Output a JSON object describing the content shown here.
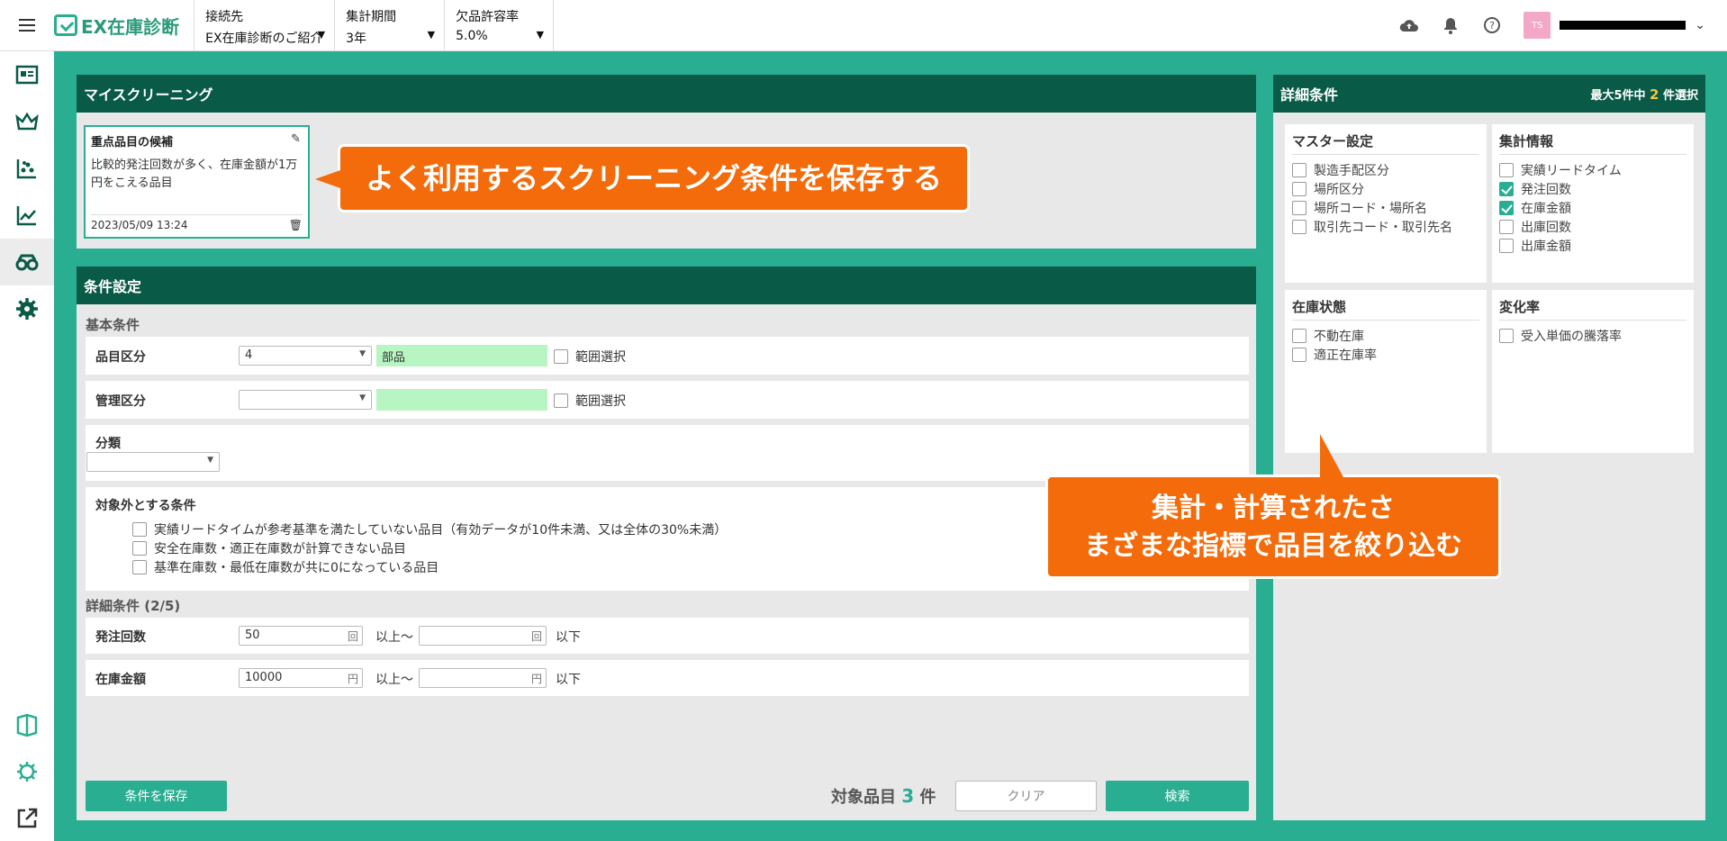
{
  "header": {
    "logo": "EX在庫診断",
    "connection": {
      "label": "接続先",
      "value": "EX在庫診断のご紹介"
    },
    "period": {
      "label": "集計期間",
      "value": "3年"
    },
    "tolerance": {
      "label": "欠品許容率",
      "value": "5.0%"
    },
    "avatar": "TS"
  },
  "my_screening": {
    "title": "マイスクリーニング",
    "card": {
      "title": "重点品目の候補",
      "description": "比較的発注回数が多く、在庫金額が1万円をこえる品目",
      "date": "2023/05/09 13:24"
    }
  },
  "callouts": {
    "save": "よく利用するスクリーニング条件を保存する",
    "filter_line1": "集計・計算されたさ",
    "filter_line2": "まざまな指標で品目を絞り込む"
  },
  "conditions": {
    "title": "条件設定",
    "basic_label": "基本条件",
    "item_class": {
      "label": "品目区分",
      "value": "4",
      "name": "部品",
      "range": "範囲選択"
    },
    "mgmt_class": {
      "label": "管理区分",
      "value": "",
      "name": "",
      "range": "範囲選択"
    },
    "category": {
      "label": "分類",
      "value": ""
    },
    "exclude": {
      "label": "対象外とする条件",
      "items": [
        "実績リードタイムが参考基準を満たしていない品目（有効データが10件未満、又は全体の30%未満）",
        "安全在庫数・適正在庫数が計算できない品目",
        "基準在庫数・最低在庫数が共に0になっている品目"
      ]
    },
    "detail_label": "詳細条件 (2/5)",
    "order_count": {
      "label": "発注回数",
      "from": "50",
      "unit": "回",
      "mid": "以上～",
      "to": "",
      "end": "以下"
    },
    "stock_value": {
      "label": "在庫金額",
      "from": "10000",
      "unit": "円",
      "mid": "以上～",
      "to": "",
      "end": "以下"
    },
    "save_button": "条件を保存",
    "target_prefix": "対象品目",
    "target_count": "3",
    "target_suffix": "件",
    "clear_button": "クリア",
    "search_button": "検索"
  },
  "detail": {
    "title": "詳細条件",
    "max_prefix": "最大5件中",
    "max_count": "2",
    "max_suffix": "件選択",
    "master": {
      "title": "マスター設定",
      "items": [
        "製造手配区分",
        "場所区分",
        "場所コード・場所名",
        "取引先コード・取引先名"
      ]
    },
    "stats": {
      "title": "集計情報",
      "items": [
        "実績リードタイム",
        "発注回数",
        "在庫金額",
        "出庫回数",
        "出庫金額"
      ],
      "checked": [
        false,
        true,
        true,
        false,
        false
      ]
    },
    "stock_state": {
      "title": "在庫状態",
      "items": [
        "不動在庫",
        "適正在庫率"
      ]
    },
    "change": {
      "title": "変化率",
      "items": [
        "受入単価の騰落率"
      ]
    }
  }
}
